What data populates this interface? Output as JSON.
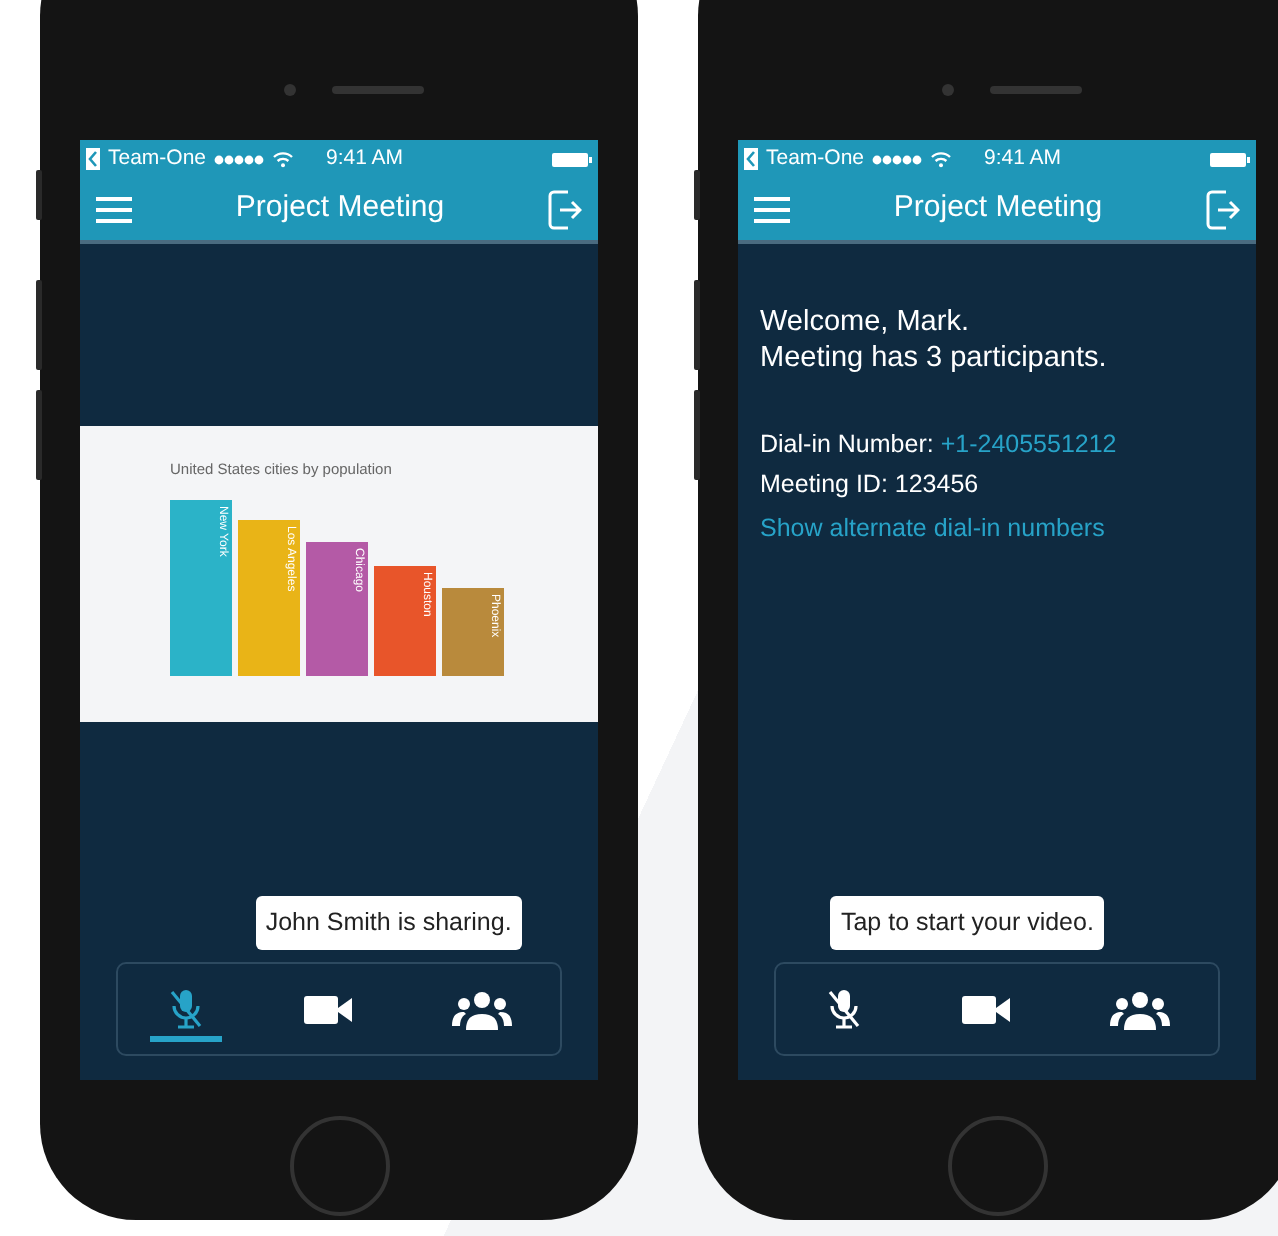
{
  "phones": [
    {
      "status_bar": {
        "back_app": "Team-One",
        "time": "9:41 AM"
      },
      "nav": {
        "title": "Project Meeting"
      },
      "content": {
        "kind": "slide",
        "chart_title": "United States cities by population",
        "bars": [
          {
            "label": "New York",
            "color": "#2bb3c8"
          },
          {
            "label": "Los Angeles",
            "color": "#e9b417"
          },
          {
            "label": "Chicago",
            "color": "#b45aa6"
          },
          {
            "label": "Houston",
            "color": "#e8552a"
          },
          {
            "label": "Phoenix",
            "color": "#b98a3c"
          }
        ]
      },
      "toolbar": [
        {
          "kind": "mic",
          "selected": true,
          "muted": true
        },
        {
          "kind": "video",
          "selected": false
        },
        {
          "kind": "participants",
          "selected": false,
          "tooltip": "John Smith is sharing."
        }
      ]
    },
    {
      "status_bar": {
        "back_app": "Team-One",
        "time": "9:41 AM"
      },
      "nav": {
        "title": "Project Meeting"
      },
      "content": {
        "kind": "welcome",
        "welcome": "Welcome, Mark.",
        "participants": "Meeting has 3 participants.",
        "dial_in_label": "Dial-in Number:",
        "dial_in_number": "+1-2405551212",
        "meeting_id": "Meeting ID: 123456",
        "alternate_link": "Show alternate dial-in numbers"
      },
      "toolbar": [
        {
          "kind": "mic",
          "selected": false,
          "muted": true
        },
        {
          "kind": "video",
          "selected": false,
          "tooltip": "Tap to start your video."
        },
        {
          "kind": "participants",
          "selected": false
        }
      ]
    }
  ]
}
